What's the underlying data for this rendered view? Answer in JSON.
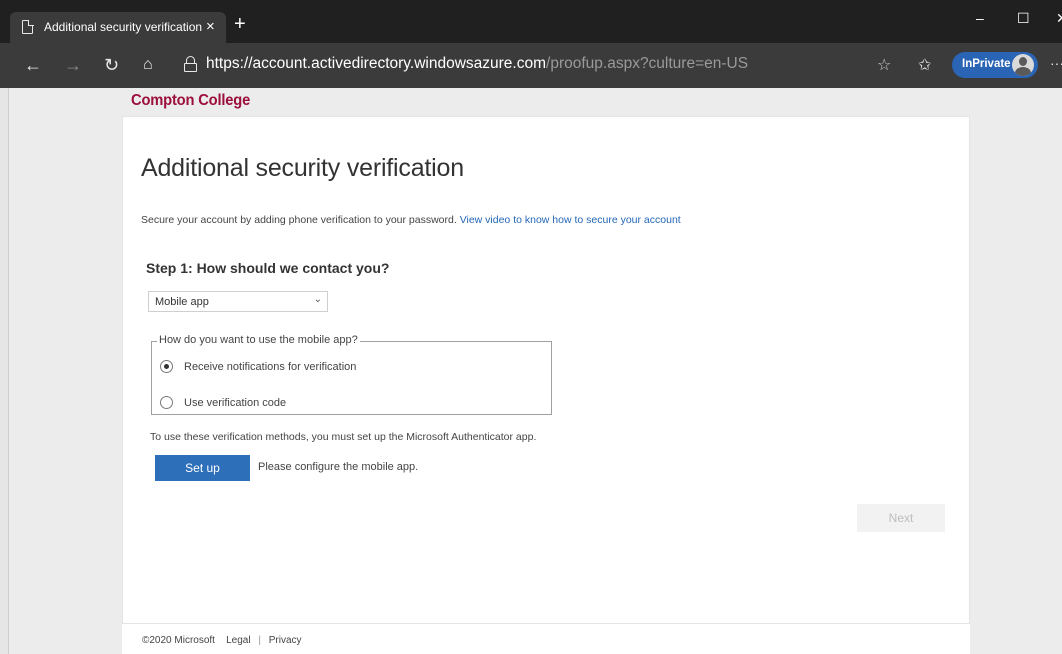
{
  "browser": {
    "tab_title": "Additional security verification",
    "tab_close": "×",
    "new_tab": "+",
    "url_main": "https://account.activedirectory.windowsazure.com",
    "url_rest": "/proofup.aspx?culture=en-US",
    "inprivate_label": "InPrivate",
    "window_controls": {
      "minimize": "–",
      "maximize": "☐",
      "close": "✕"
    },
    "more": "···"
  },
  "brand": {
    "name": "Compton College",
    "color": "#9c0f3c"
  },
  "main": {
    "title": "Additional security verification",
    "intro_text": "Secure your account by adding phone verification to your password. ",
    "intro_link": "View video to know how to secure your account",
    "step_title": "Step 1: How should we contact you?",
    "contact_method": {
      "selected": "Mobile app"
    },
    "mobile_app_group": {
      "legend": "How do you want to use the mobile app?",
      "options": [
        {
          "label": "Receive notifications for verification",
          "checked": true
        },
        {
          "label": "Use verification code",
          "checked": false
        }
      ]
    },
    "authenticator_note": "To use these verification methods, you must set up the Microsoft Authenticator app.",
    "setup_button": "Set up",
    "setup_hint": "Please configure the mobile app.",
    "next_button": "Next"
  },
  "footer": {
    "copyright": "©2020 Microsoft",
    "legal": "Legal",
    "separator": "|",
    "privacy": "Privacy"
  },
  "colors": {
    "accent": "#2e6fba",
    "link": "#2467b7",
    "inprivate_badge": "#2a64b5"
  }
}
